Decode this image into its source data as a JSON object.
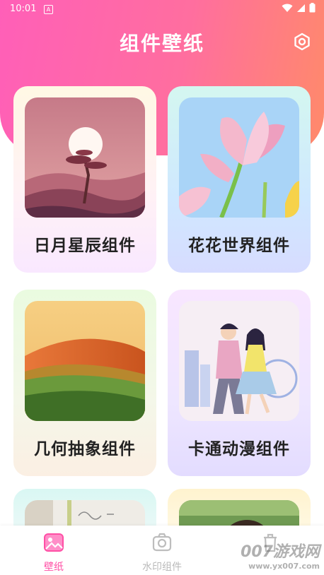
{
  "status_bar": {
    "time": "10:01",
    "badge": "A"
  },
  "header": {
    "title": "组件壁纸",
    "settings_icon": "hexagon-gear-icon"
  },
  "cards": [
    {
      "label": "日月星辰组件"
    },
    {
      "label": "花花世界组件"
    },
    {
      "label": "几何抽象组件"
    },
    {
      "label": "卡通动漫组件"
    }
  ],
  "bottom_nav": {
    "items": [
      {
        "label": "壁纸",
        "icon": "image-icon",
        "active": true
      },
      {
        "label": "水印组件",
        "icon": "camera-icon",
        "active": false
      },
      {
        "label": "",
        "icon": "trash-icon",
        "active": false
      }
    ]
  },
  "watermark": {
    "brand": "007游戏网",
    "url": "www.yx007.com"
  },
  "colors": {
    "accent": "#ff4fa5",
    "header_start": "#ff5fb8",
    "header_end": "#ff8a6a"
  }
}
